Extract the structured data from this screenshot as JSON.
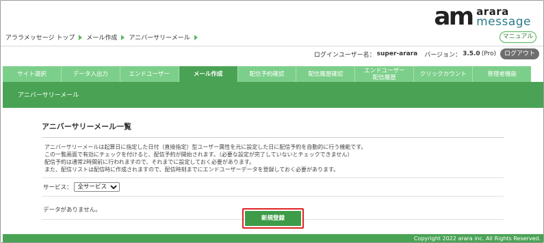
{
  "logo": {
    "mark": "am",
    "line1": "arara",
    "line2": "message"
  },
  "breadcrumb": [
    "アララメッセージ トップ",
    "メール作成",
    "アニバーサリーメール"
  ],
  "header": {
    "manual_label": "マニュアル",
    "login_prefix": "ログインユーザー名：",
    "login_user": "super-arara",
    "version_prefix": "バージョン：",
    "version": "3.5.0",
    "version_suffix": "(Pro)",
    "logout_label": "ログアウト"
  },
  "tabs": [
    {
      "label": "サイト選択"
    },
    {
      "label": "データ入出力"
    },
    {
      "label": "エンドユーザー"
    },
    {
      "label": "メール作成",
      "active": true
    },
    {
      "label": "配信予約確認"
    },
    {
      "label": "配信履歴確認"
    },
    {
      "label": "エンドユーザー\n配信履歴"
    },
    {
      "label": "クリックカウント"
    },
    {
      "label": "管理者機能"
    }
  ],
  "page": {
    "heading": "アニバーサリーメール",
    "section_title": "アニバーサリーメール一覧",
    "description": [
      "アニバーサリーメールは起算日に指定した日付（直接指定）型ユーザー属性を元に設定した日に配信予約を自動的に行う機能です。",
      "この一覧画面で有効にチェックを付けると、配信予約が開始されます。（必要な設定が完了していないとチェックできません）",
      "配信予約は通常2時間前に行われますので、それまでに設定しておく必要があります。",
      "また、配信リストは配信時に作成されますので、配信時刻までにエンドユーザーデータを登録しておく必要があります。"
    ],
    "service_label": "サービス：",
    "service_selected": "全サービス",
    "no_data": "データがありません。",
    "new_button": "新規登録"
  },
  "footer": {
    "copyright": "Copyright 2022 arara inc. All Rights Reserved."
  },
  "colors": {
    "accent": "#4aa355",
    "tab": "#7ccf8a",
    "highlight_border": "#e02020"
  }
}
